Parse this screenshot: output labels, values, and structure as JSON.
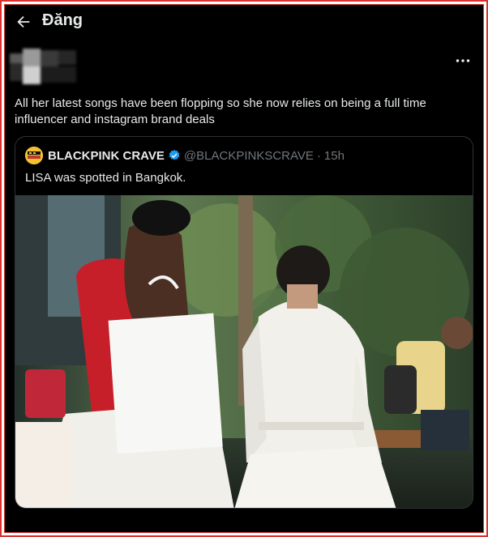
{
  "header": {
    "title": "Đăng",
    "back_icon": "arrow-left-icon"
  },
  "post": {
    "author_name_hidden": true,
    "more_icon": "more-horizontal-icon",
    "text": "All her latest songs have been flopping so she now relies on being a full time influencer and instagram brand deals"
  },
  "quote": {
    "name": "BLACKPINK CRAVE",
    "handle": "@BLACKPINKSCRAVE",
    "dot": "·",
    "time": "15h",
    "text": "LISA was spotted in Bangkok.",
    "verified_color": "#1d9bf0",
    "media_alt": "Photo of two women walking with shopping bags"
  },
  "colors": {
    "background": "#000000",
    "text": "#e7e9ea",
    "muted": "#71767b",
    "border": "#2f3336",
    "frame": "#d9322e"
  }
}
